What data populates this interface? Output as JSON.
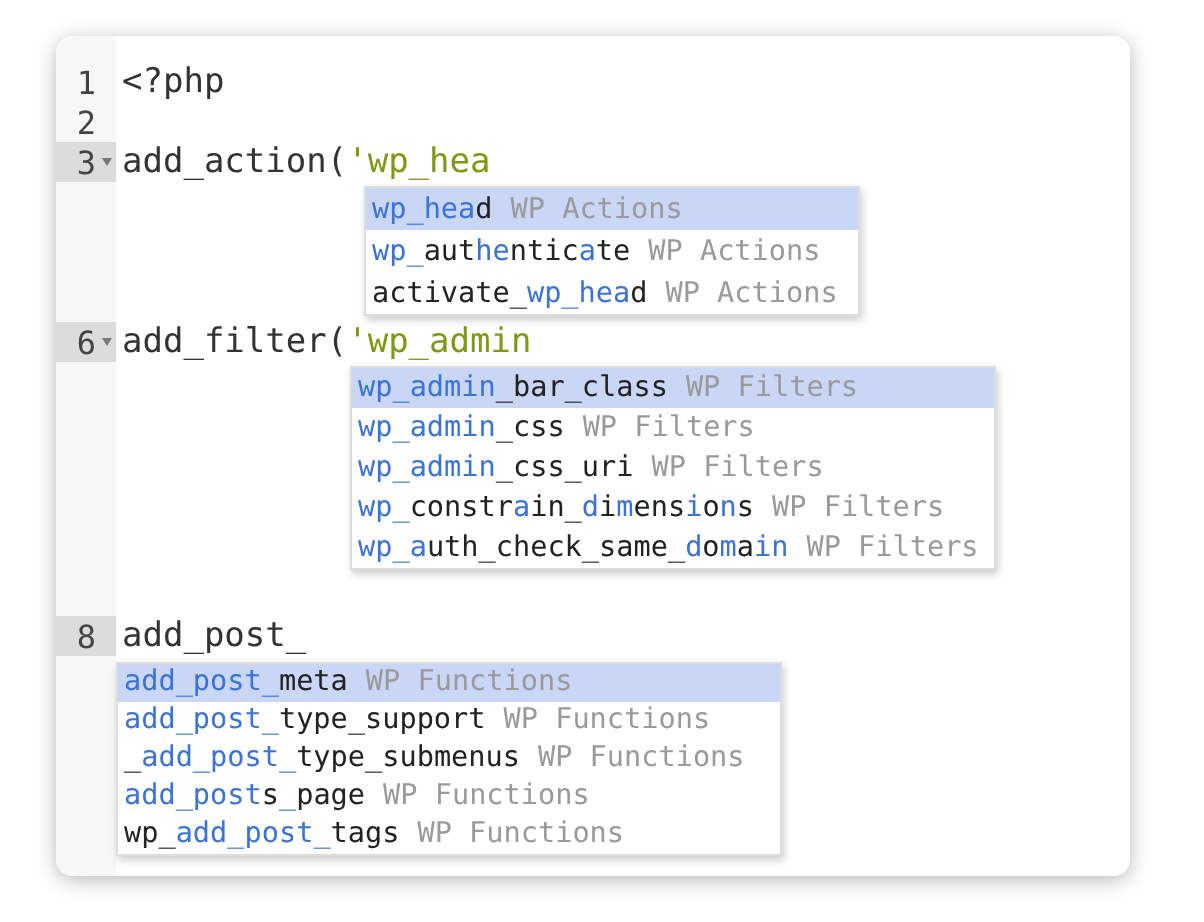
{
  "editor": {
    "lines": [
      {
        "number": "1",
        "active": false,
        "foldable": false,
        "tokens": [
          {
            "kind": "plain",
            "text": "<?php"
          }
        ]
      },
      {
        "number": "2",
        "active": false,
        "foldable": false
      },
      {
        "number": "3",
        "active": true,
        "foldable": true,
        "tokens": [
          {
            "kind": "plain",
            "text": "add_action("
          },
          {
            "kind": "string",
            "text": "'wp_hea"
          }
        ],
        "autocomplete": {
          "items": [
            {
              "selected": true,
              "meta": "WP Actions",
              "segments": [
                {
                  "text": "wp_hea",
                  "match": true
                },
                {
                  "text": "d",
                  "match": false
                }
              ]
            },
            {
              "selected": false,
              "meta": "WP Actions",
              "segments": [
                {
                  "text": "wp_",
                  "match": true
                },
                {
                  "text": "aut",
                  "match": false
                },
                {
                  "text": "he",
                  "match": true
                },
                {
                  "text": "ntic",
                  "match": false
                },
                {
                  "text": "a",
                  "match": true
                },
                {
                  "text": "te",
                  "match": false
                }
              ]
            },
            {
              "selected": false,
              "meta": "WP Actions",
              "segments": [
                {
                  "text": "activate_",
                  "match": false
                },
                {
                  "text": "wp_hea",
                  "match": true
                },
                {
                  "text": "d",
                  "match": false
                }
              ]
            }
          ]
        }
      },
      {
        "number": "6",
        "active": true,
        "foldable": true,
        "tokens": [
          {
            "kind": "plain",
            "text": "add_filter("
          },
          {
            "kind": "string",
            "text": "'wp_admin"
          }
        ],
        "autocomplete": {
          "items": [
            {
              "selected": true,
              "meta": "WP Filters",
              "segments": [
                {
                  "text": "wp_admin",
                  "match": true
                },
                {
                  "text": "_bar_class",
                  "match": false
                }
              ]
            },
            {
              "selected": false,
              "meta": "WP Filters",
              "segments": [
                {
                  "text": "wp_admin",
                  "match": true
                },
                {
                  "text": "_css",
                  "match": false
                }
              ]
            },
            {
              "selected": false,
              "meta": "WP Filters",
              "segments": [
                {
                  "text": "wp_admin",
                  "match": true
                },
                {
                  "text": "_css_uri",
                  "match": false
                }
              ]
            },
            {
              "selected": false,
              "meta": "WP Filters",
              "segments": [
                {
                  "text": "wp_",
                  "match": true
                },
                {
                  "text": "constr",
                  "match": false
                },
                {
                  "text": "a",
                  "match": true
                },
                {
                  "text": "in_",
                  "match": false
                },
                {
                  "text": "d",
                  "match": true
                },
                {
                  "text": "i",
                  "match": false
                },
                {
                  "text": "m",
                  "match": true
                },
                {
                  "text": "ens",
                  "match": false
                },
                {
                  "text": "i",
                  "match": true
                },
                {
                  "text": "o",
                  "match": false
                },
                {
                  "text": "n",
                  "match": true
                },
                {
                  "text": "s",
                  "match": false
                }
              ]
            },
            {
              "selected": false,
              "meta": "WP Filters",
              "segments": [
                {
                  "text": "wp_a",
                  "match": true
                },
                {
                  "text": "uth_check_same_",
                  "match": false
                },
                {
                  "text": "d",
                  "match": true
                },
                {
                  "text": "o",
                  "match": false
                },
                {
                  "text": "m",
                  "match": true
                },
                {
                  "text": "a",
                  "match": false
                },
                {
                  "text": "in",
                  "match": true
                }
              ]
            }
          ]
        }
      },
      {
        "number": "8",
        "active": true,
        "foldable": false,
        "tokens": [
          {
            "kind": "plain",
            "text": "add_post_"
          }
        ],
        "autocomplete": {
          "items": [
            {
              "selected": true,
              "meta": "WP Functions",
              "segments": [
                {
                  "text": "add_post_",
                  "match": true
                },
                {
                  "text": "meta",
                  "match": false
                }
              ]
            },
            {
              "selected": false,
              "meta": "WP Functions",
              "segments": [
                {
                  "text": "add_post_",
                  "match": true
                },
                {
                  "text": "type_support",
                  "match": false
                }
              ]
            },
            {
              "selected": false,
              "meta": "WP Functions",
              "segments": [
                {
                  "text": "_",
                  "match": false
                },
                {
                  "text": "add_post_",
                  "match": true
                },
                {
                  "text": "type_submenus",
                  "match": false
                }
              ]
            },
            {
              "selected": false,
              "meta": "WP Functions",
              "segments": [
                {
                  "text": "add_post",
                  "match": true
                },
                {
                  "text": "s",
                  "match": false
                },
                {
                  "text": "_",
                  "match": true
                },
                {
                  "text": "page",
                  "match": false
                }
              ]
            },
            {
              "selected": false,
              "meta": "WP Functions",
              "segments": [
                {
                  "text": "wp_",
                  "match": false
                },
                {
                  "text": "add_post_",
                  "match": true
                },
                {
                  "text": "tags",
                  "match": false
                }
              ]
            }
          ]
        }
      }
    ]
  }
}
